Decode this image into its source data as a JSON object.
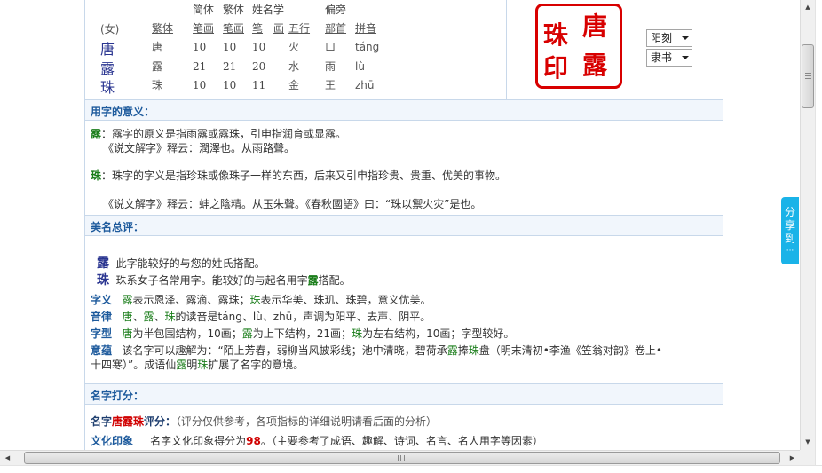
{
  "name_table": {
    "headers_top": [
      "简体",
      "繁体",
      "姓名学",
      "偏旁"
    ],
    "headers_bottom": [
      "繁体",
      "笔画",
      "笔画",
      "笔",
      "画",
      "五行",
      "部首",
      "拼音"
    ],
    "female_tag": "(女)",
    "rows": [
      {
        "char": "唐",
        "trad": "唐",
        "simp": "10",
        "trad_strokes": "10",
        "xm": "10",
        "wuxing": "火",
        "radical": "口",
        "pinyin": "táng"
      },
      {
        "char": "露",
        "trad": "露",
        "simp": "21",
        "trad_strokes": "21",
        "xm": "20",
        "wuxing": "水",
        "radical": "雨",
        "pinyin": "lù"
      },
      {
        "char": "珠",
        "trad": "珠",
        "simp": "10",
        "trad_strokes": "10",
        "xm": "11",
        "wuxing": "金",
        "radical": "王",
        "pinyin": "zhū"
      }
    ]
  },
  "seal": {
    "chars": [
      "唐",
      "露",
      "珠",
      "印"
    ]
  },
  "selects": {
    "style1": "阳刻",
    "style2": "隶书"
  },
  "meaning": {
    "heading": "用字的意义：",
    "lu_char": "露",
    "lu_text": "：露字的原义是指雨露或露珠，引申指润育或显露。",
    "lu_quote": "《说文解字》释云：潤澤也。从雨路聲。",
    "zhu_char": "珠",
    "zhu_text": "：珠字的字义是指珍珠或像珠子一样的东西，后来又引申指珍贵、贵重、优美的事物。",
    "zhu_quote": "《说文解字》释云：蚌之陰精。从玉朱聲。《春秋國語》曰：“珠以禦火灾”是也。"
  },
  "review": {
    "heading": "美名总评：",
    "lu_char": "露",
    "lu_line": "此字能较好的与您的姓氏搭配。",
    "zhu_char": "珠",
    "zhu_pre": "珠系女子名常用字。能较好的与起名用字",
    "zhu_hl": "露",
    "zhu_post": "搭配。",
    "ziyi_label": "字义",
    "ziyi_a": "露",
    "ziyi_b": "表示恩泽、露滴、露珠；",
    "ziyi_c": "珠",
    "ziyi_d": "表示华美、珠玑、珠碧，意义优美。",
    "yinlv_label": "音律",
    "yinlv_a": "唐",
    "yinlv_sep1": "、",
    "yinlv_b": "露",
    "yinlv_sep2": "、",
    "yinlv_c": "珠",
    "yinlv_d": "的读音是táng、lù、zhū，声调为阳平、去声、阴平。",
    "zixing_label": "字型",
    "zixing_a": "唐",
    "zixing_b": "为半包围结构，10画；",
    "zixing_c": "露",
    "zixing_d": "为上下结构，21画；",
    "zixing_e": "珠",
    "zixing_f": "为左右结构，10画；字型较好。",
    "yiyun_label": "意蕴",
    "yiyun_a": "该名字可以趣解为：“陌上芳春，弱柳当风披彩线；池中清晓，碧荷承",
    "yiyun_b": "露",
    "yiyun_c": "捧",
    "yiyun_d": "珠",
    "yiyun_e": "盘（明末清初•李渔《笠翁对韵》卷上•",
    "yiyun_f": "十四寒）”。成语仙",
    "yiyun_g": "露",
    "yiyun_h": "明",
    "yiyun_i": "珠",
    "yiyun_j": "扩展了名字的意境。"
  },
  "score": {
    "heading": "名字打分：",
    "title_pre": "名字",
    "title_name": "唐露珠",
    "title_post": "评分：",
    "title_note": "（评分仅供参考，各项指标的详细说明请看后面的分析）",
    "culture_label": "文化印象",
    "culture_pre": "名字文化印象得分为",
    "culture_value": "98",
    "culture_post": "。（主要参考了成语、趣解、诗词、名言、名人用字等因素）"
  },
  "share": {
    "label": "分享到"
  },
  "share_dots": "···"
}
